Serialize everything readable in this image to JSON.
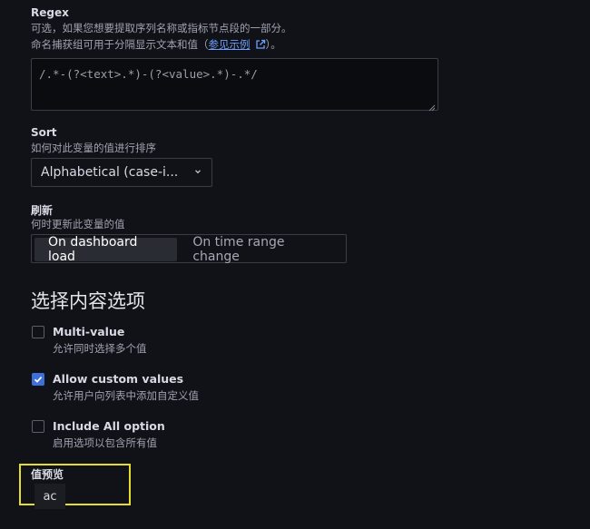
{
  "regex": {
    "label": "Regex",
    "desc_line1": "可选，如果您想要提取序列名称或指标节点段的一部分。",
    "desc_line2_pre": "命名捕获组可用于分隔显示文本和值（",
    "link_text": "参见示例",
    "desc_line2_post": "）。",
    "value": "/.*-(?<text>.*)-(?<value>.*)-.*/"
  },
  "sort": {
    "label": "Sort",
    "desc": "如何对此变量的值进行排序",
    "selected": "Alphabetical (case-i..."
  },
  "refresh": {
    "label": "刷新",
    "desc": "何时更新此变量的值",
    "options": [
      "On dashboard load",
      "On time range change"
    ],
    "active_index": 0
  },
  "selection": {
    "title": "选择内容选项",
    "multi_value": {
      "label": "Multi-value",
      "desc": "允许同时选择多个值",
      "checked": false
    },
    "allow_custom": {
      "label": "Allow custom values",
      "desc": "允许用户向列表中添加自定义值",
      "checked": true
    },
    "include_all": {
      "label": "Include All option",
      "desc": "启用选项以包含所有值",
      "checked": false
    }
  },
  "preview": {
    "label": "值预览",
    "values": [
      "ac"
    ]
  },
  "colors": {
    "accent": "#3d71d9",
    "highlight": "#e6dc2e",
    "background": "#111217"
  }
}
